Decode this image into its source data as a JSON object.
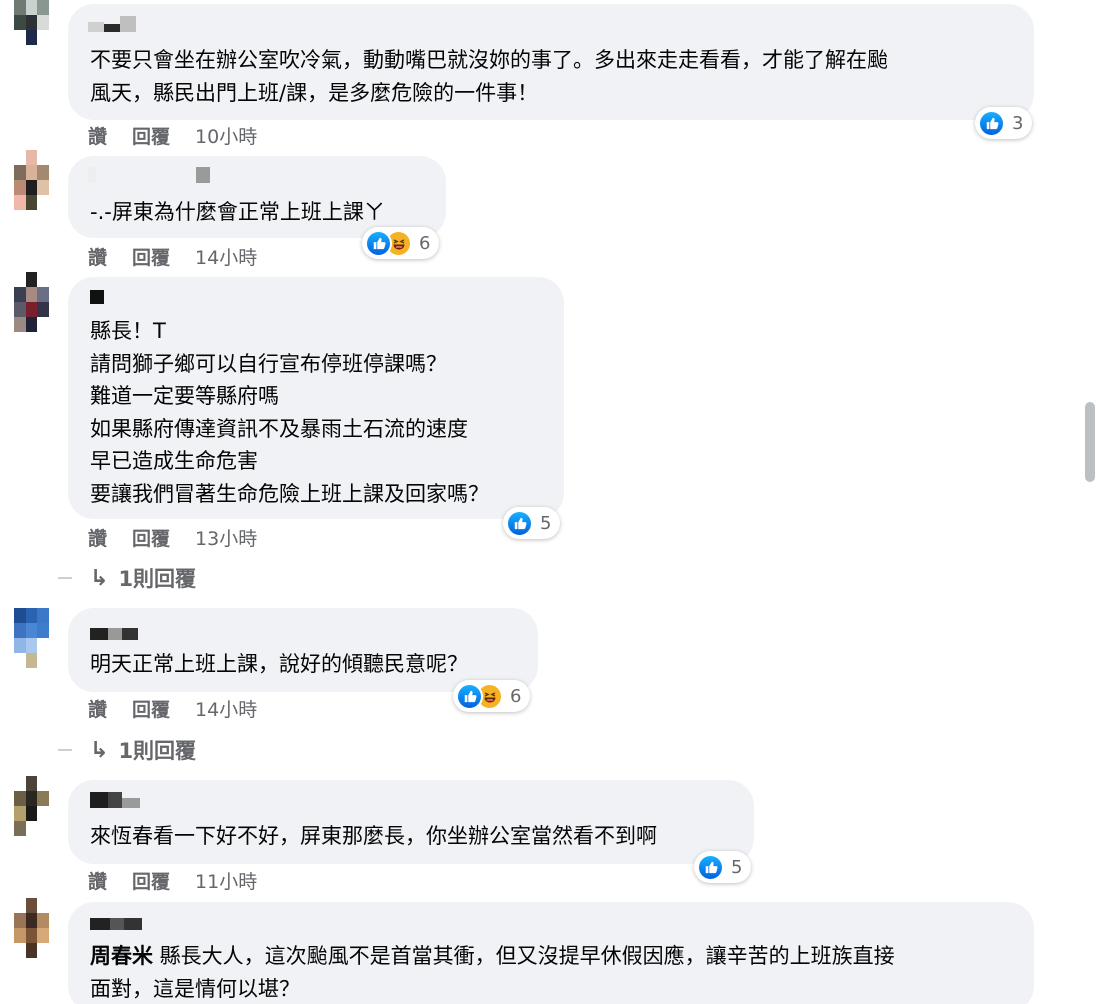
{
  "comments": [
    {
      "text": "不要只會坐在辦公室吹冷氣，動動嘴巴就沒妳的事了。多出來走走看看，才能了解在颱\n風天，縣民出門上班/課，是多麼危險的一件事！",
      "actions": {
        "like": "讚",
        "reply": "回覆",
        "time": "10小時"
      },
      "reactions": {
        "types": [
          "like"
        ],
        "count": "3"
      }
    },
    {
      "text": "-.-屏東為什麼會正常上班上課ㄚ",
      "actions": {
        "like": "讚",
        "reply": "回覆",
        "time": "14小時"
      },
      "reactions": {
        "types": [
          "like",
          "haha"
        ],
        "count": "6"
      }
    },
    {
      "text": "縣長！T\n請問獅子鄉可以自行宣布停班停課嗎？\n難道一定要等縣府嗎\n如果縣府傳達資訊不及暴雨土石流的速度\n早已造成生命危害\n要讓我們冒著生命危險上班上課及回家嗎？",
      "actions": {
        "like": "讚",
        "reply": "回覆",
        "time": "13小時"
      },
      "reactions": {
        "types": [
          "like"
        ],
        "count": "5"
      },
      "replies": "1則回覆"
    },
    {
      "text": "明天正常上班上課，說好的傾聽民意呢？",
      "actions": {
        "like": "讚",
        "reply": "回覆",
        "time": "14小時"
      },
      "reactions": {
        "types": [
          "like",
          "haha"
        ],
        "count": "6"
      },
      "replies": "1則回覆"
    },
    {
      "text": "來恆春看一下好不好，屏東那麼長，你坐辦公室當然看不到啊",
      "actions": {
        "like": "讚",
        "reply": "回覆",
        "time": "11小時"
      },
      "reactions": {
        "types": [
          "like"
        ],
        "count": "5"
      }
    },
    {
      "mention": "周春米",
      "text": " 縣長大人，這次颱風不是首當其衝，但又沒提早休假因應，讓辛苦的上班族直接\n面對，這是情何以堪？"
    }
  ],
  "icons": {
    "like": "thumbs-up-icon",
    "haha": "laughing-face-icon",
    "reply_arrow": "reply-arrow-icon"
  },
  "colors": {
    "bubble": "#f0f2f5",
    "like_blue": "#1877f2",
    "haha_yellow": "#f7b125",
    "meta_gray": "#65676b"
  }
}
